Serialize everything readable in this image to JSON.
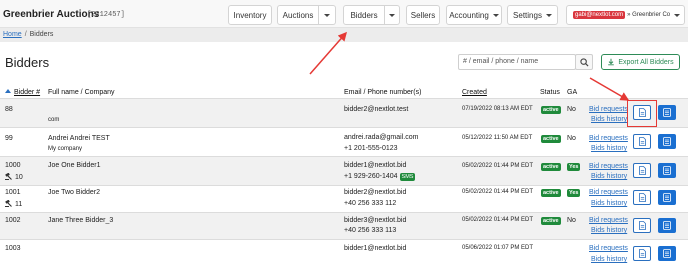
{
  "brand": {
    "name": "Greenbrier Auctions",
    "id": "[2212457]"
  },
  "nav": {
    "inventory": "Inventory",
    "auctions": "Auctions",
    "bidders": "Bidders",
    "sellers": "Sellers",
    "accounting": "Accounting",
    "settings": "Settings",
    "user_email": "gabi@nextlot.com",
    "user_org": "» Greenbrier Co"
  },
  "breadcrumb": {
    "home": "Home",
    "separator": "/",
    "current": "Bidders"
  },
  "page_title": "Bidders",
  "search": {
    "placeholder": "# / email / phone / name",
    "icon": "search-icon"
  },
  "export": {
    "label": "Export All Bidders",
    "icon": "download-icon"
  },
  "table": {
    "headers": {
      "bidder_num": "Bidder #",
      "name": "Full name / Company",
      "email": "Email / Phone number(s)",
      "created": "Created",
      "status": "Status",
      "ga": "GA"
    },
    "rows": [
      {
        "num": "88",
        "gavels": "",
        "name": "",
        "company": "com",
        "email": "bidder2@nextlot.test",
        "phone": "",
        "sms": "",
        "created": "07/19/2022 08:13 AM EDT",
        "status": "active",
        "ga": "No",
        "link1": "Bid requests",
        "link2": "Bids history"
      },
      {
        "num": "99",
        "gavels": "",
        "name": "Andrei Andrei TEST",
        "company": "My company",
        "email": "andrei.rada@gmail.com",
        "phone": "+1 201-555-0123",
        "sms": "",
        "created": "05/12/2022 11:50 AM EDT",
        "status": "active",
        "ga": "No",
        "link1": "Bid requests",
        "link2": "Bids history"
      },
      {
        "num": "1000",
        "gavels": "10",
        "name": "Joe One Bidder1",
        "company": "",
        "email": "bidder1@nextlot.bid",
        "phone": "+1 929-260-1404",
        "sms": "SMS",
        "created": "05/02/2022 01:44 PM EDT",
        "status": "active",
        "ga": "Yes",
        "link1": "Bid requests",
        "link2": "Bids history"
      },
      {
        "num": "1001",
        "gavels": "11",
        "name": "Joe Two Bidder2",
        "company": "",
        "email": "bidder2@nextlot.bid",
        "phone": "+40 256 333 112",
        "sms": "",
        "created": "05/02/2022 01:44 PM EDT",
        "status": "active",
        "ga": "Yes",
        "link1": "Bid requests",
        "link2": "Bids history"
      },
      {
        "num": "1002",
        "gavels": "",
        "name": "Jane Three Bidder_3",
        "company": "",
        "email": "bidder3@nextlot.bid",
        "phone": "+40 256 333 113",
        "sms": "",
        "created": "05/02/2022 01:44 PM EDT",
        "status": "active",
        "ga": "No",
        "link1": "Bid requests",
        "link2": "Bids history"
      },
      {
        "num": "1003",
        "gavels": "",
        "name": "",
        "company": "",
        "email": "bidder1@nextlot.bid",
        "phone": "",
        "sms": "",
        "created": "05/06/2022 01:07 PM EDT",
        "status": "",
        "ga": "",
        "link1": "Bid requests",
        "link2": "Bids history"
      }
    ]
  },
  "colors": {
    "accent_blue": "#2a6fbf",
    "button_blue": "#1a6fd1",
    "active_green": "#1f8a3b",
    "annotation_red": "#e53935"
  }
}
